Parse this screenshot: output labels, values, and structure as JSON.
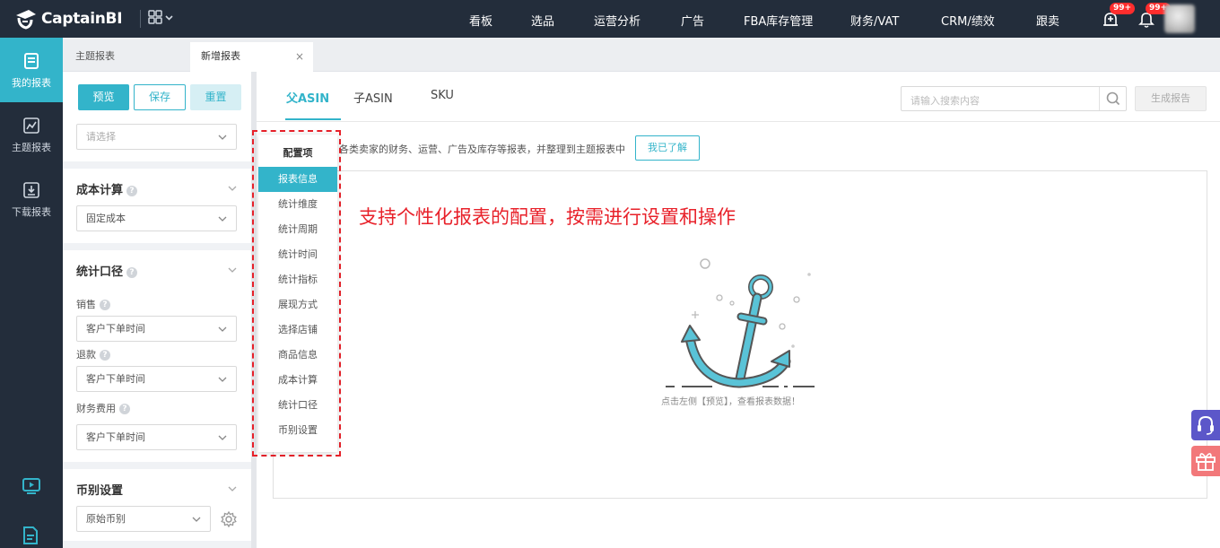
{
  "app": {
    "brand": "CaptainBI",
    "colors": {
      "accent": "#33b4ca",
      "topbar": "#232d3b",
      "annotation": "#e8212a",
      "badge": "#ff2d2d"
    }
  },
  "topnav": {
    "items": [
      "看板",
      "选品",
      "运营分析",
      "广告",
      "FBA库存管理",
      "财务/VAT",
      "CRM/绩效",
      "跟卖"
    ],
    "badges": [
      "99+",
      "99+"
    ]
  },
  "rail": {
    "items": [
      {
        "label": "我的报表",
        "icon": "report-icon",
        "active": true
      },
      {
        "label": "主题报表",
        "icon": "chart-icon",
        "active": false
      },
      {
        "label": "下载报表",
        "icon": "download-icon",
        "active": false
      }
    ]
  },
  "tabs": [
    {
      "label": "主题报表",
      "active": false
    },
    {
      "label": "新增报表",
      "active": true,
      "close": "×"
    }
  ],
  "panel": {
    "buttons": {
      "preview": "预览",
      "save": "保存",
      "reset": "重置"
    },
    "select_placeholder": "请选择",
    "cost": {
      "title": "成本计算",
      "value": "固定成本"
    },
    "scope": {
      "title": "统计口径",
      "sales_label": "销售",
      "sales_value": "客户下单时间",
      "refund_label": "退款",
      "refund_value": "客户下单时间",
      "fee_label": "财务费用",
      "fee_value": "客户下单时间"
    },
    "currency": {
      "title": "币别设置",
      "value": "原始币别"
    },
    "help_glyph": "?"
  },
  "main": {
    "subtabs": [
      "父ASIN",
      "子ASIN",
      "SKU"
    ],
    "search_placeholder": "请输入搜索内容",
    "generate_button": "生成报告",
    "notice": "各类卖家的财务、运营、广告及库存等报表，并整理到主题报表中",
    "ack_button": "我已了解",
    "annotation": "支持个性化报表的配置，按需进行设置和操作",
    "empty_text": "点击左侧【预览】，查看报表数据！"
  },
  "menu": {
    "title": "配置项",
    "items": [
      "报表信息",
      "统计维度",
      "统计周期",
      "统计时间",
      "统计指标",
      "展现方式",
      "选择店铺",
      "商品信息",
      "成本计算",
      "统计口径",
      "币别设置"
    ],
    "active_index": 0
  }
}
